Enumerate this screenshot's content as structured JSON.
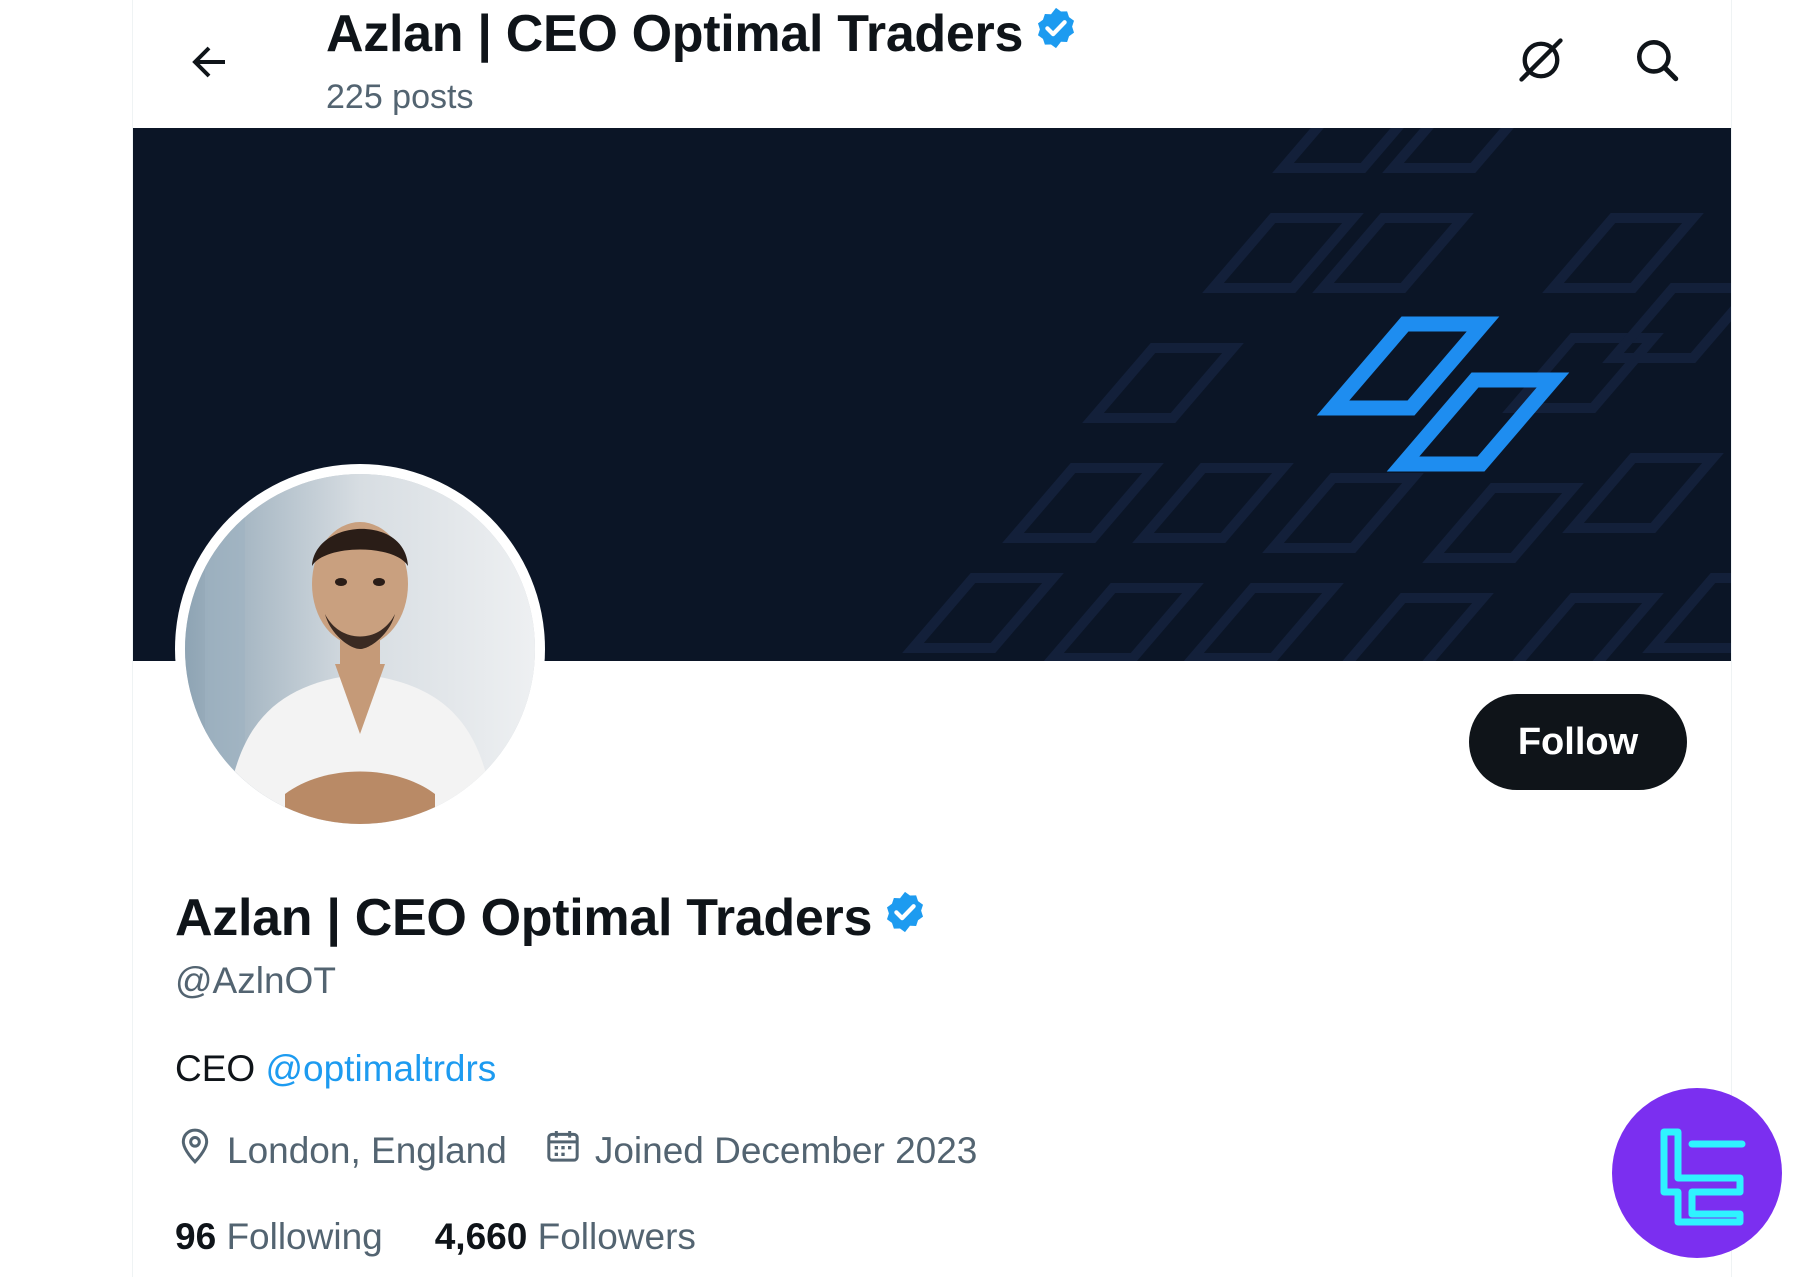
{
  "header": {
    "title": "Azlan | CEO Optimal Traders",
    "posts_count": "225 posts"
  },
  "profile": {
    "display_name": "Azlan | CEO Optimal Traders",
    "handle": "@AzlnOT",
    "bio_prefix": "CEO",
    "bio_mention": "@optimaltrdrs",
    "location": "London, England",
    "joined": "Joined December 2023",
    "following_count": "96",
    "following_label": "Following",
    "followers_count": "4,660",
    "followers_label": "Followers",
    "verified": true
  },
  "actions": {
    "follow_label": "Follow"
  },
  "icons": {
    "back": "arrow-left-icon",
    "grok": "grok-icon",
    "search": "search-icon",
    "verified": "verified-badge-icon",
    "location": "location-pin-icon",
    "calendar": "calendar-icon"
  },
  "colors": {
    "accent": "#1d9bf0",
    "banner_bg": "#0b1526",
    "text_primary": "#0f1419",
    "text_secondary": "#536471",
    "follow_bg": "#0f1419",
    "watermark_bg": "#7b2ff0",
    "watermark_fg": "#2ff3ff"
  }
}
